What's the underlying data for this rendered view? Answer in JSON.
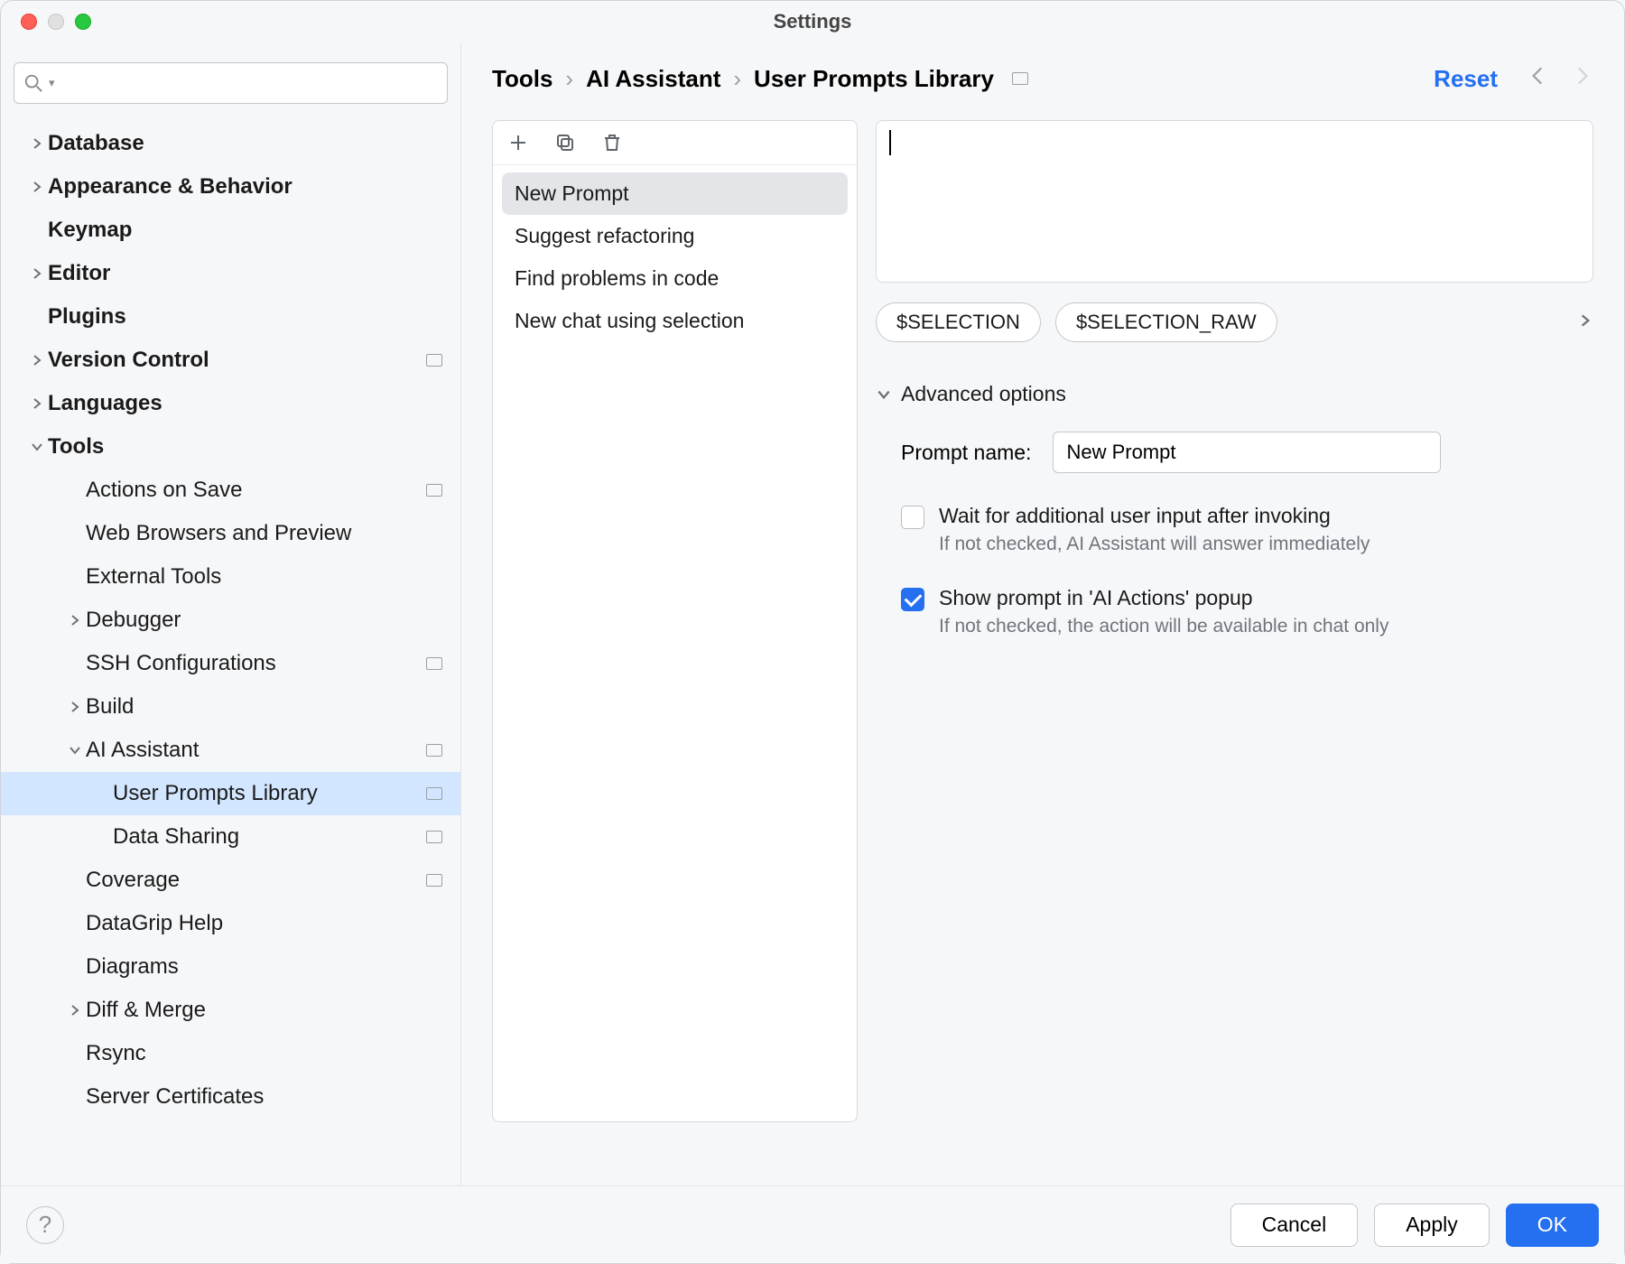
{
  "window": {
    "title": "Settings"
  },
  "search": {
    "placeholder": ""
  },
  "tree": {
    "database": "Database",
    "appearance": "Appearance & Behavior",
    "keymap": "Keymap",
    "editor": "Editor",
    "plugins": "Plugins",
    "version_control": "Version Control",
    "languages": "Languages",
    "tools": "Tools",
    "actions_on_save": "Actions on Save",
    "web_browsers": "Web Browsers and Preview",
    "external_tools": "External Tools",
    "debugger": "Debugger",
    "ssh_config": "SSH Configurations",
    "build": "Build",
    "ai_assistant": "AI Assistant",
    "user_prompts": "User Prompts Library",
    "data_sharing": "Data Sharing",
    "coverage": "Coverage",
    "datagrip_help": "DataGrip Help",
    "diagrams": "Diagrams",
    "diff_merge": "Diff & Merge",
    "rsync": "Rsync",
    "server_certs": "Server Certificates"
  },
  "breadcrumb": {
    "a": "Tools",
    "b": "AI Assistant",
    "c": "User Prompts Library"
  },
  "reset_label": "Reset",
  "prompts": {
    "items": [
      {
        "label": "New Prompt",
        "selected": true
      },
      {
        "label": "Suggest refactoring",
        "selected": false
      },
      {
        "label": "Find problems in code",
        "selected": false
      },
      {
        "label": "New chat using selection",
        "selected": false
      }
    ]
  },
  "vars": {
    "selection": "$SELECTION",
    "selection_raw": "$SELECTION_RAW"
  },
  "advanced": {
    "header": "Advanced options",
    "prompt_name_label": "Prompt name:",
    "prompt_name_value": "New Prompt",
    "wait_label": "Wait for additional user input after invoking",
    "wait_hint": "If not checked, AI Assistant will answer immediately",
    "wait_checked": false,
    "show_label": "Show prompt in 'AI Actions' popup",
    "show_hint": "If not checked, the action will be available in chat only",
    "show_checked": true
  },
  "footer": {
    "cancel": "Cancel",
    "apply": "Apply",
    "ok": "OK",
    "help": "?"
  }
}
